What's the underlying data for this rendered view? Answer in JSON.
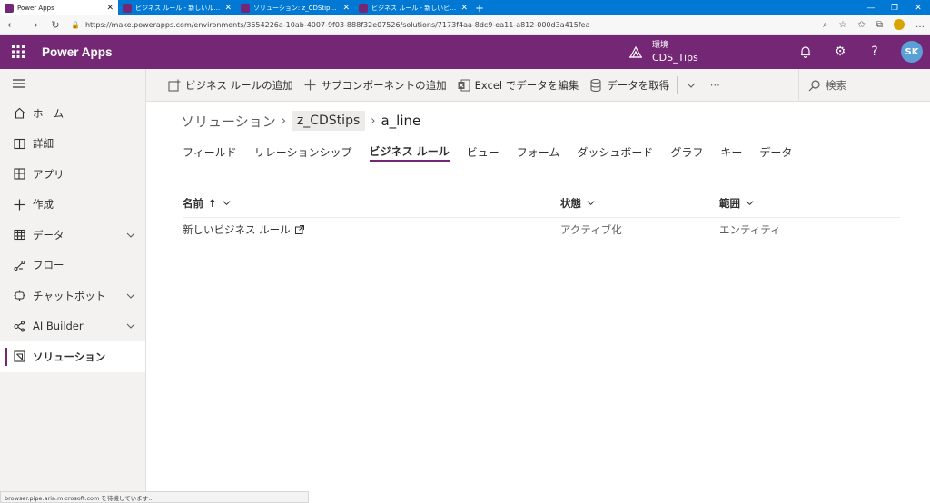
{
  "browser": {
    "tabs": [
      {
        "title": "Power Apps",
        "active": true
      },
      {
        "title": "ビジネス ルール - 新しいルール - Mic",
        "active": false
      },
      {
        "title": "ソリューション: z_CDStips - Micros",
        "active": false
      },
      {
        "title": "ビジネス ルール - 新しいビジネス ル",
        "active": false
      }
    ],
    "url": "https://make.powerapps.com/environments/3654226a-10ab-4007-9f03-888f32e07526/solutions/7173f4aa-8dc9-ea11-a812-000d3a415fea",
    "status_text": "browser.pipe.aria.microsoft.com を待機しています..."
  },
  "header": {
    "app_name": "Power Apps",
    "env_label": "環境",
    "env_name": "CDS_Tips",
    "avatar_initials": "SK",
    "brand_color": "#742774"
  },
  "leftnav": {
    "items": [
      {
        "label": "ホーム",
        "icon": "home-icon"
      },
      {
        "label": "詳細",
        "icon": "book-icon"
      },
      {
        "label": "アプリ",
        "icon": "apps-icon"
      },
      {
        "label": "作成",
        "icon": "plus-icon"
      },
      {
        "label": "データ",
        "icon": "table-icon",
        "expandable": true
      },
      {
        "label": "フロー",
        "icon": "flow-icon"
      },
      {
        "label": "チャットボット",
        "icon": "chatbot-icon",
        "expandable": true
      },
      {
        "label": "AI Builder",
        "icon": "ai-builder-icon",
        "expandable": true
      },
      {
        "label": "ソリューション",
        "icon": "solution-icon",
        "active": true
      }
    ]
  },
  "commandbar": {
    "add_business_rule": "ビジネス ルールの追加",
    "add_subcomponent": "サブコンポーネントの追加",
    "edit_in_excel": "Excel でデータを編集",
    "get_data": "データを取得",
    "search": "検索"
  },
  "breadcrumb": {
    "root": "ソリューション",
    "solution": "z_CDStips",
    "entity": "a_line"
  },
  "pivots": [
    "フィールド",
    "リレーションシップ",
    "ビジネス ルール",
    "ビュー",
    "フォーム",
    "ダッシュボード",
    "グラフ",
    "キー",
    "データ"
  ],
  "active_pivot": "ビジネス ルール",
  "grid": {
    "columns": [
      "名前",
      "状態",
      "範囲"
    ],
    "sort_indicator": "↑",
    "rows": [
      {
        "name": "新しいビジネス ルール",
        "state": "アクティブ化",
        "scope": "エンティティ"
      }
    ]
  }
}
